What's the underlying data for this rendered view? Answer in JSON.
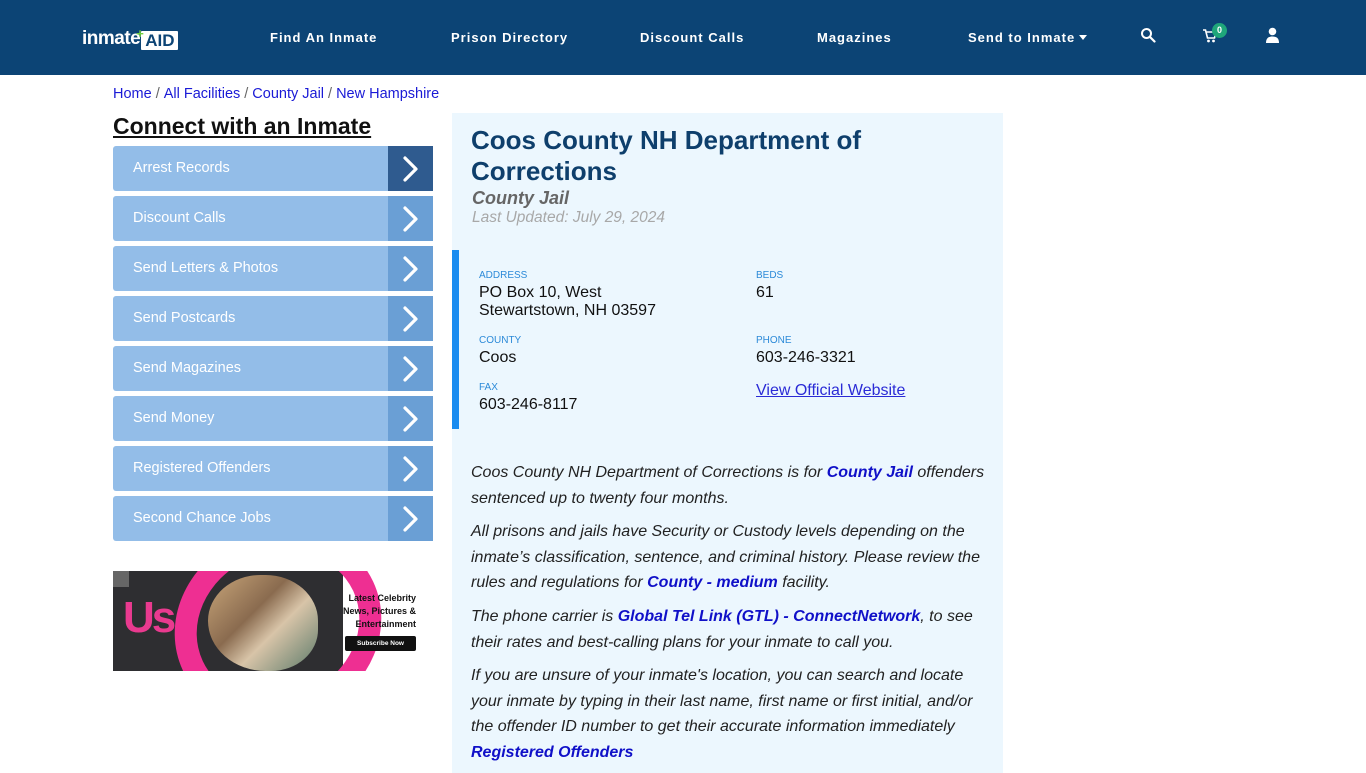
{
  "header": {
    "logo_text_1": "inmate",
    "logo_text_2": "AID",
    "nav": [
      {
        "label": "Find An Inmate"
      },
      {
        "label": "Prison Directory"
      },
      {
        "label": "Discount Calls"
      },
      {
        "label": "Magazines"
      },
      {
        "label": "Send to Inmate",
        "has_dropdown": true
      }
    ],
    "cart_count": "0",
    "icons": [
      "search-icon",
      "cart-icon",
      "user-icon"
    ]
  },
  "breadcrumb": [
    "Home",
    "All Facilities",
    "County Jail",
    "New Hampshire"
  ],
  "sidebar": {
    "title": "Connect with an Inmate",
    "items": [
      {
        "label": "Arrest Records"
      },
      {
        "label": "Discount Calls"
      },
      {
        "label": "Send Letters & Photos"
      },
      {
        "label": "Send Postcards"
      },
      {
        "label": "Send Magazines"
      },
      {
        "label": "Send Money"
      },
      {
        "label": "Registered Offenders"
      },
      {
        "label": "Second Chance Jobs"
      }
    ],
    "ad": {
      "brand": "Us",
      "tagline_1": "Latest Celebrity",
      "tagline_2": "News, Pictures &",
      "tagline_3": "Entertainment",
      "cta": "Subscribe Now"
    }
  },
  "facility": {
    "title": "Coos County NH Department of Corrections",
    "type": "County Jail",
    "last_updated": "Last Updated: July 29, 2024",
    "address_label": "Address",
    "address_line1": "PO Box 10, West",
    "address_line2": "Stewartstown, NH 03597",
    "beds_label": "Beds",
    "beds": "61",
    "county_label": "County",
    "county": "Coos",
    "phone_label": "Phone",
    "phone": "603-246-3321",
    "fax_label": "Fax",
    "fax": "603-246-8117",
    "website_link": "View Official Website"
  },
  "description": {
    "p1_a": "Coos County NH Department of Corrections is for ",
    "p1_link": "County Jail",
    "p1_b": " offenders sentenced up to twenty four months.",
    "p2_a": "All prisons and jails have Security or Custody levels depending on the inmate’s classification, sentence, and criminal history. Please review the rules and regulations for ",
    "p2_link": "County - medium",
    "p2_b": " facility.",
    "p3_a": "The phone carrier is ",
    "p3_link": "Global Tel Link (GTL) - ConnectNetwork",
    "p3_b": ", to see their rates and best-calling plans for your inmate to call you.",
    "p4_a": "If you are unsure of your inmate's location, you can search and locate your inmate by typing in their last name, first name or first initial, and/or the offender ID number to get their accurate information immediately ",
    "p4_link": "Registered Offenders"
  },
  "colors": {
    "header_bg": "#0c4475",
    "sidebar_item_bg": "#93bde8",
    "sidebar_arrow_bg": "#6a9fd5",
    "sidebar_arrow_active": "#2f5b8f",
    "panel_bg": "#ecf7fe",
    "accent_border": "#1a8cf0",
    "link": "#1010c8"
  }
}
